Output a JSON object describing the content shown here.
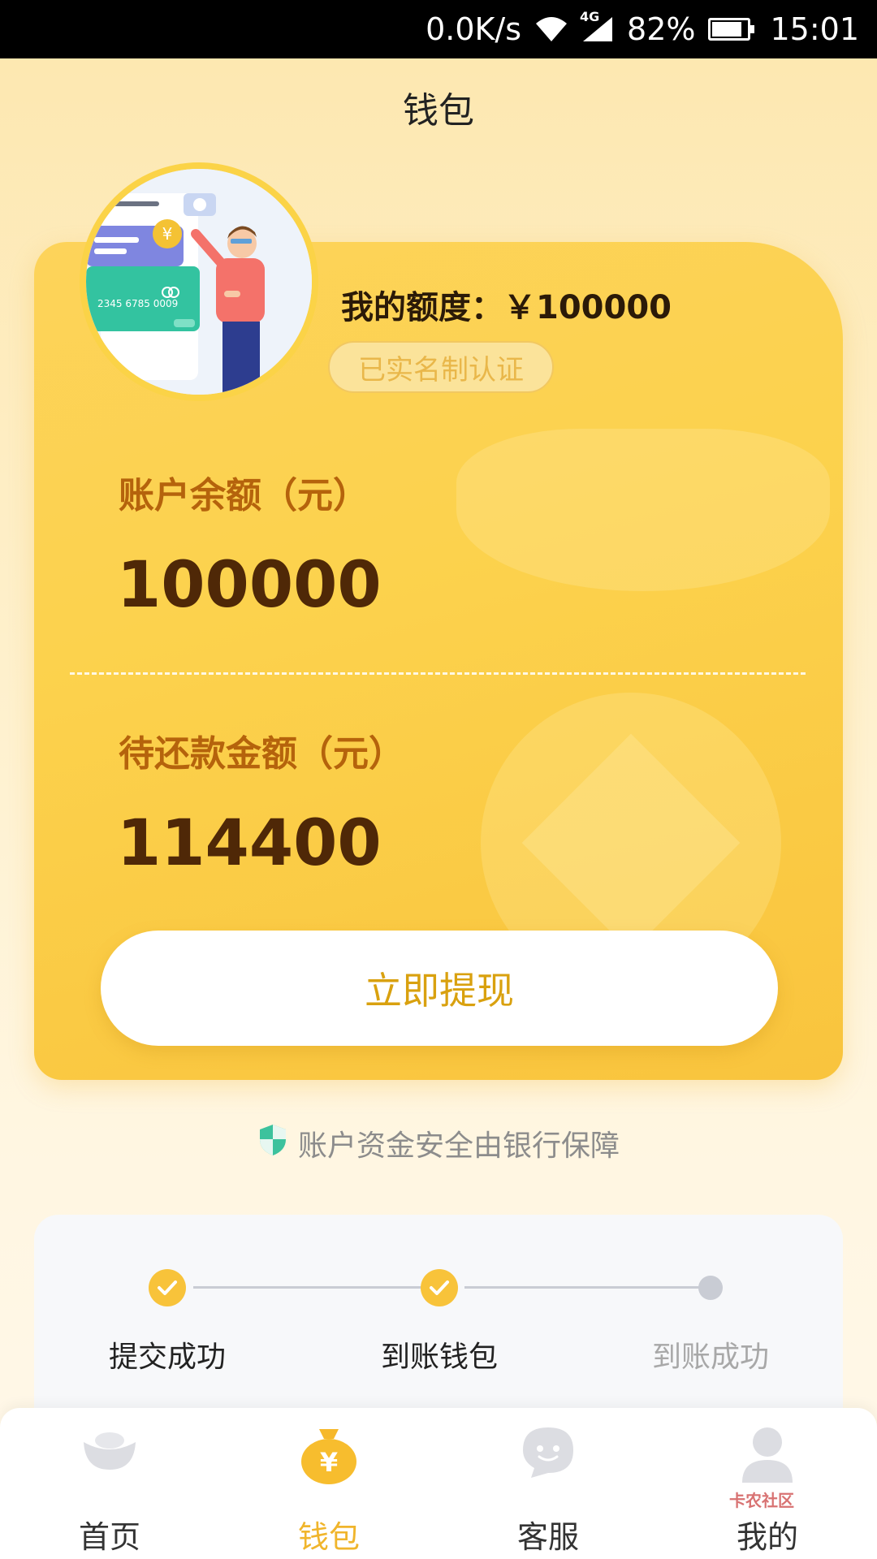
{
  "status_bar": {
    "speed": "0.0K/s",
    "network": "4G",
    "battery": "82%",
    "time": "15:01"
  },
  "header": {
    "title": "钱包"
  },
  "wallet": {
    "quota_label": "我的额度：￥100000",
    "verified_badge": "已实名制认证",
    "balance_label": "账户余额（元）",
    "balance_value": "100000",
    "due_label": "待还款金额（元）",
    "due_value": "114400",
    "withdraw_button": "立即提现"
  },
  "illustration": {
    "card_number": "2345 6785 0009"
  },
  "security_note": "账户资金安全由银行保障",
  "progress": {
    "steps": [
      {
        "label": "提交成功",
        "done": true
      },
      {
        "label": "到账钱包",
        "done": true
      },
      {
        "label": "到账成功",
        "done": false
      }
    ]
  },
  "tab_bar": {
    "items": [
      {
        "label": "首页",
        "icon": "ingot-icon",
        "active": false
      },
      {
        "label": "钱包",
        "icon": "money-bag-icon",
        "active": true
      },
      {
        "label": "客服",
        "icon": "chat-icon",
        "active": false
      },
      {
        "label": "我的",
        "icon": "user-icon",
        "active": false
      }
    ]
  },
  "watermark": "卡农社区",
  "colors": {
    "accent": "#f8c33a",
    "card": "#fcd24d",
    "label_orange": "#b5630c",
    "value_brown": "#4f2807",
    "button_text": "#d9a10f"
  }
}
